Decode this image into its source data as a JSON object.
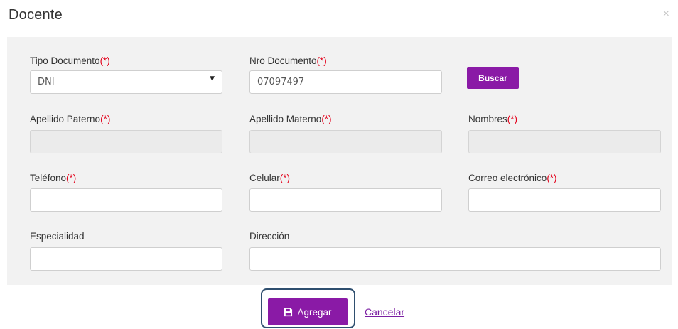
{
  "modal": {
    "title": "Docente",
    "close_glyph": "×"
  },
  "form": {
    "tipo_documento": {
      "label": "Tipo Documento",
      "required": "(*)",
      "value": "DNI"
    },
    "nro_documento": {
      "label": "Nro Documento",
      "required": "(*)",
      "value": "07097497"
    },
    "buscar_label": "Buscar",
    "apellido_paterno": {
      "label": "Apellido Paterno",
      "required": "(*)",
      "value": ""
    },
    "apellido_materno": {
      "label": "Apellido Materno",
      "required": "(*)",
      "value": ""
    },
    "nombres": {
      "label": "Nombres",
      "required": "(*)",
      "value": ""
    },
    "telefono": {
      "label": "Teléfono",
      "required": "(*)",
      "value": ""
    },
    "celular": {
      "label": "Celular",
      "required": "(*)",
      "value": ""
    },
    "correo": {
      "label": "Correo electrónico",
      "required": "(*)",
      "value": ""
    },
    "especialidad": {
      "label": "Especialidad",
      "value": ""
    },
    "direccion": {
      "label": "Dirección",
      "value": ""
    }
  },
  "footer": {
    "add_label": "Agregar",
    "add_icon": "save-icon",
    "cancel_label": "Cancelar"
  },
  "colors": {
    "accent": "#8a1aa6",
    "required": "#e3001b",
    "panel_bg": "#f2f2f2"
  }
}
